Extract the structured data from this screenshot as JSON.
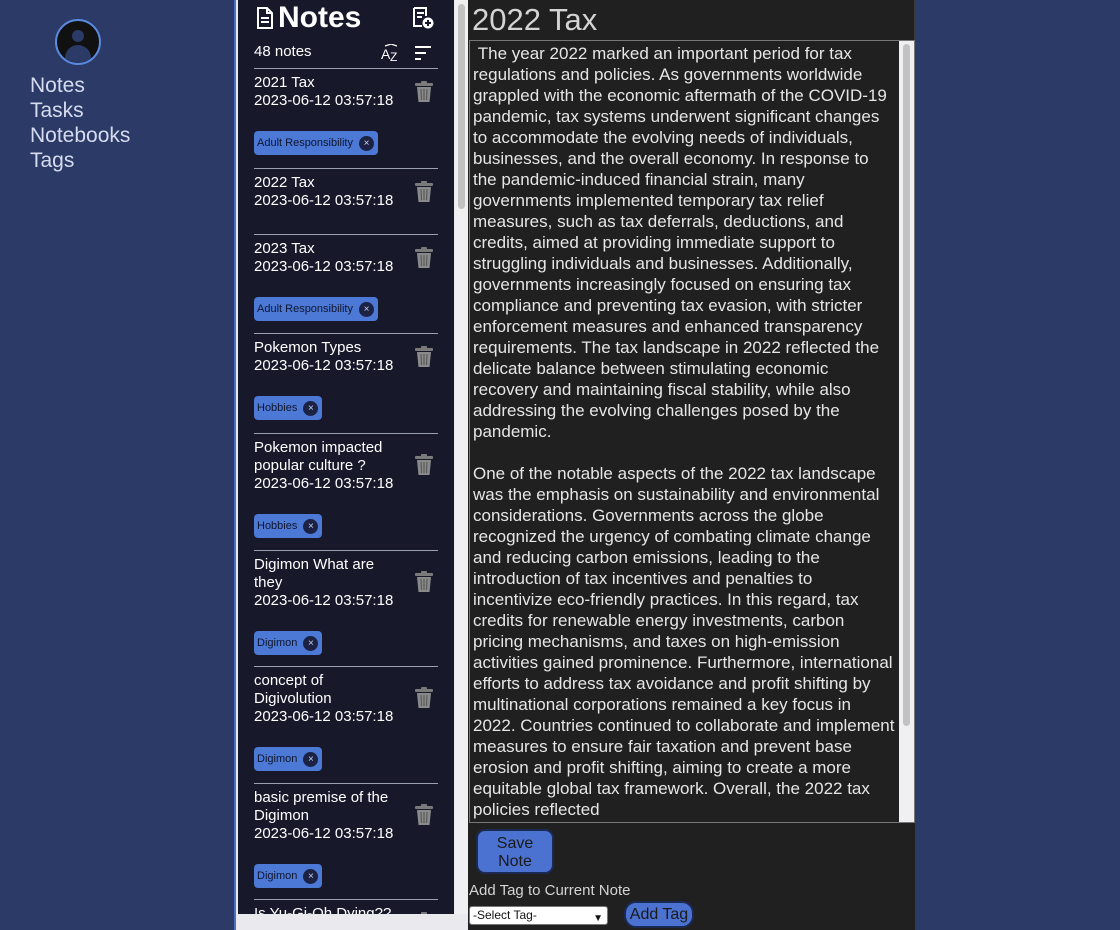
{
  "nav": {
    "items": [
      {
        "label": "Notes"
      },
      {
        "label": "Tasks"
      },
      {
        "label": "Notebooks"
      },
      {
        "label": "Tags"
      }
    ]
  },
  "notes_panel": {
    "title": "Notes",
    "count_label": "48 notes",
    "icons": {
      "title": "document-icon",
      "new": "new-note-icon",
      "sort_alpha": "sort-az-icon",
      "sort": "sort-lines-icon",
      "delete": "trash-icon"
    },
    "notes": [
      {
        "title": "2021 Tax",
        "date": "2023-06-12 03:57:18",
        "tag": "Adult Responsibility"
      },
      {
        "title": "2022 Tax",
        "date": "2023-06-12 03:57:18",
        "tag": ""
      },
      {
        "title": "2023 Tax",
        "date": "2023-06-12 03:57:18",
        "tag": "Adult Responsibility"
      },
      {
        "title": "Pokemon Types",
        "date": "2023-06-12 03:57:18",
        "tag": "Hobbies"
      },
      {
        "title": "Pokemon impacted popular culture ?",
        "date": "2023-06-12 03:57:18",
        "tag": "Hobbies"
      },
      {
        "title": "Digimon What are they",
        "date": "2023-06-12 03:57:18",
        "tag": "Digimon"
      },
      {
        "title": "concept of Digivolution",
        "date": "2023-06-12 03:57:18",
        "tag": "Digimon"
      },
      {
        "title": "basic premise of the Digimon",
        "date": "2023-06-12 03:57:18",
        "tag": "Digimon"
      },
      {
        "title": "Is Yu-Gi-Oh Dying??",
        "date": "",
        "tag": ""
      }
    ],
    "tag_remove_glyph": "×"
  },
  "editor": {
    "title": "2022 Tax",
    "body": " The year 2022 marked an important period for tax regulations and policies. As governments worldwide grappled with the economic aftermath of the COVID-19 pandemic, tax systems underwent significant changes to accommodate the evolving needs of individuals, businesses, and the overall economy. In response to the pandemic-induced financial strain, many governments implemented temporary tax relief measures, such as tax deferrals, deductions, and credits, aimed at providing immediate support to struggling individuals and businesses. Additionally, governments increasingly focused on ensuring tax compliance and preventing tax evasion, with stricter enforcement measures and enhanced transparency requirements. The tax landscape in 2022 reflected the delicate balance between stimulating economic recovery and maintaining fiscal stability, while also addressing the evolving challenges posed by the pandemic.\n\nOne of the notable aspects of the 2022 tax landscape was the emphasis on sustainability and environmental considerations. Governments across the globe recognized the urgency of combating climate change and reducing carbon emissions, leading to the introduction of tax incentives and penalties to incentivize eco-friendly practices. In this regard, tax credits for renewable energy investments, carbon pricing mechanisms, and taxes on high-emission activities gained prominence. Furthermore, international efforts to address tax avoidance and profit shifting by multinational corporations remained a key focus in 2022. Countries continued to collaborate and implement measures to ensure fair taxation and prevent base erosion and profit shifting, aiming to create a more equitable global tax framework. Overall, the 2022 tax policies reflected",
    "save_label": "Save Note",
    "add_tag_label": "Add Tag to Current Note",
    "select_value": "-Select Tag-",
    "add_tag_button": "Add Tag"
  }
}
